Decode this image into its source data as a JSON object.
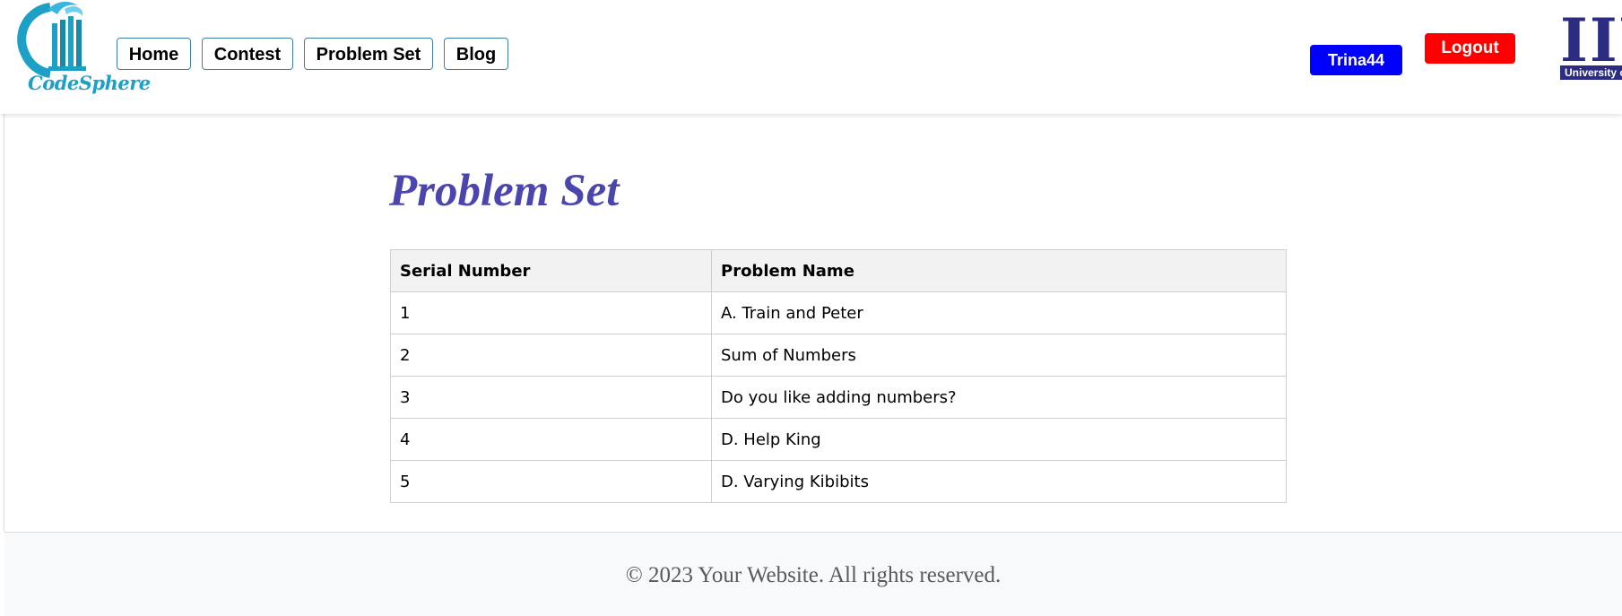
{
  "brand": {
    "name": "CodeSphere",
    "accent": "#1e9fc6"
  },
  "nav": {
    "home": "Home",
    "contest": "Contest",
    "problem_set": "Problem Set",
    "blog": "Blog"
  },
  "user": {
    "username": "Trina44",
    "logout": "Logout",
    "user_color": "#0000ff",
    "logout_color": "#ff0000"
  },
  "university_logo": {
    "letters": "IIU",
    "caption": "University of"
  },
  "page": {
    "title": "Problem Set",
    "title_color": "#4b46ad"
  },
  "table": {
    "headers": [
      "Serial Number",
      "Problem Name"
    ],
    "rows": [
      [
        "1",
        "A. Train and Peter"
      ],
      [
        "2",
        "Sum of Numbers"
      ],
      [
        "3",
        "Do you like adding numbers?"
      ],
      [
        "4",
        "D. Help King"
      ],
      [
        "5",
        "D. Varying Kibibits"
      ]
    ]
  },
  "footer": {
    "text": "© 2023 Your Website. All rights reserved."
  }
}
